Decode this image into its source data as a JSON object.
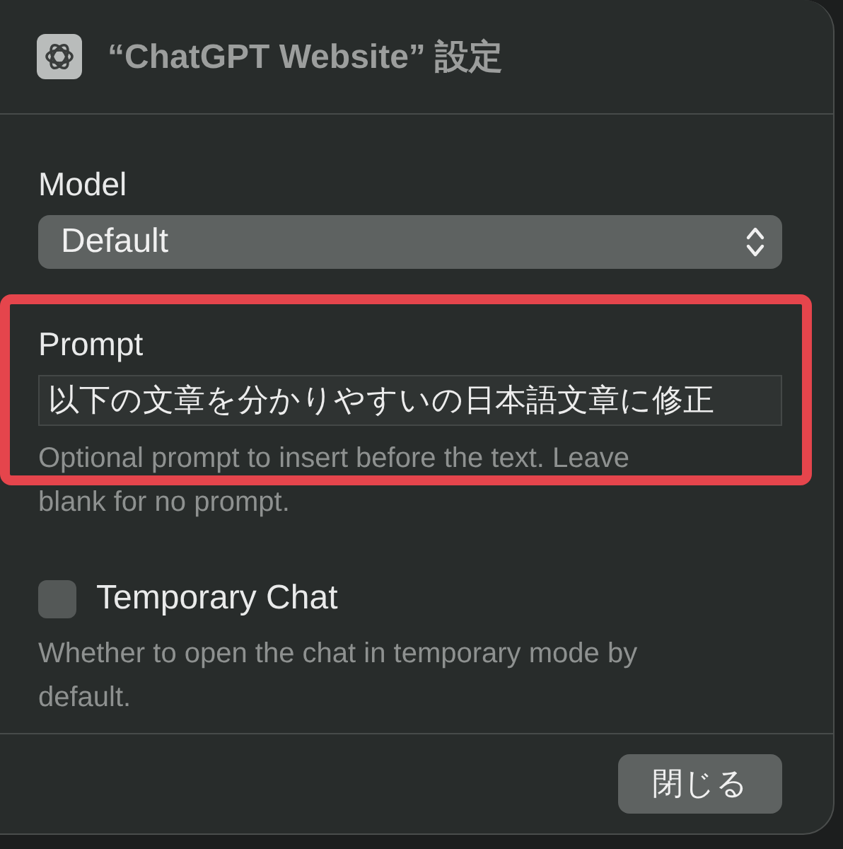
{
  "window": {
    "title": "“ChatGPT Website” 設定"
  },
  "fields": [
    {
      "kind": "select",
      "label": "Model",
      "value": "Default"
    },
    {
      "kind": "text",
      "label": "Prompt",
      "value": "以下の文章を分かりやすいの日本語文章に修正",
      "help": "Optional prompt to insert before the text. Leave blank for no prompt.",
      "highlighted": true
    },
    {
      "kind": "checkbox",
      "label": "Temporary Chat",
      "checked": false,
      "help": "Whether to open the chat in temporary mode by default."
    }
  ],
  "buttons": [
    "閉じる"
  ]
}
